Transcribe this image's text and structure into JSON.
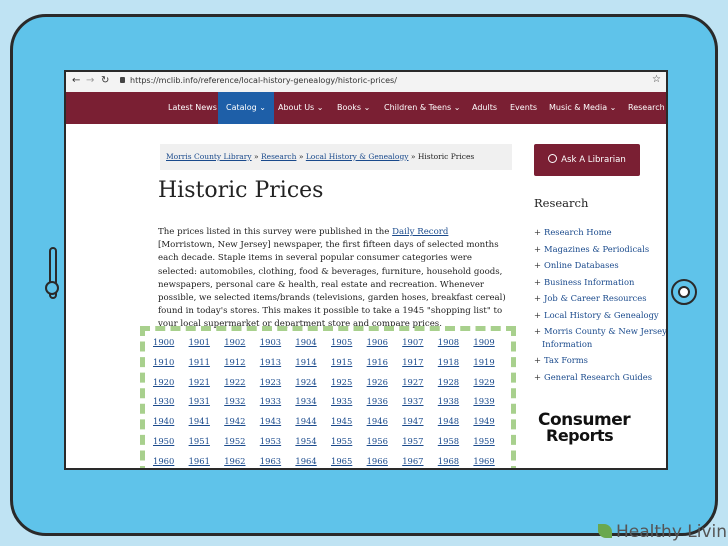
{
  "browser": {
    "url": "https://mclib.info/reference/local-history-genealogy/historic-prices/"
  },
  "nav": {
    "items": [
      "Latest News",
      "Catalog",
      "About Us",
      "Books",
      "Children & Teens",
      "Adults",
      "Events",
      "Music & Media",
      "Research"
    ],
    "active": "Catalog"
  },
  "breadcrumb": {
    "home": "Morris County Library",
    "sep": "»",
    "level1": "Research",
    "level2": "Local History & Genealogy",
    "current": "Historic Prices"
  },
  "page": {
    "title": "Historic Prices",
    "intro_before": "The prices listed in this survey were published in the ",
    "intro_link": "Daily Record",
    "intro_after": " [Morristown, New Jersey] newspaper, the first fifteen days of selected months each decade. Staple items in several popular consumer categories were selected: automobiles, clothing, food & beverages, furniture, household goods, newspapers, personal care & health, real estate and recreation. Whenever possible, we selected items/brands (televisions, garden hoses, breakfast cereal) found in today's stores. This makes it possible to take a 1945 \"shopping list\" to your local supermarket or department store and compare prices."
  },
  "years": [
    [
      "1900",
      "1901",
      "1902",
      "1903",
      "1904",
      "1905",
      "1906",
      "1907",
      "1908",
      "1909"
    ],
    [
      "1910",
      "1911",
      "1912",
      "1913",
      "1914",
      "1915",
      "1916",
      "1917",
      "1918",
      "1919"
    ],
    [
      "1920",
      "1921",
      "1922",
      "1923",
      "1924",
      "1925",
      "1926",
      "1927",
      "1928",
      "1929"
    ],
    [
      "1930",
      "1931",
      "1932",
      "1933",
      "1934",
      "1935",
      "1936",
      "1937",
      "1938",
      "1939"
    ],
    [
      "1940",
      "1941",
      "1942",
      "1943",
      "1944",
      "1945",
      "1946",
      "1947",
      "1948",
      "1949"
    ],
    [
      "1950",
      "1951",
      "1952",
      "1953",
      "1954",
      "1955",
      "1956",
      "1957",
      "1958",
      "1959"
    ],
    [
      "1960",
      "1961",
      "1962",
      "1963",
      "1964",
      "1965",
      "1966",
      "1967",
      "1968",
      "1969"
    ]
  ],
  "sidebar": {
    "ask_button": "Ask A Librarian",
    "research_heading": "Research",
    "links": [
      "Research Home",
      "Magazines & Periodicals",
      "Online Databases",
      "Business Information",
      "Job & Career Resources",
      "Local History & Genealogy",
      "Morris County & New Jersey",
      "Information",
      "Tax Forms",
      "General Research Guides"
    ],
    "logo_line1": "Consumer",
    "logo_line2": "Reports"
  },
  "watermark": "Healthy Living",
  "colors": {
    "nav": "#7a1f33",
    "active_tab": "#1e5fa8",
    "link": "#1a4a8c",
    "highlight": "#a8d08d",
    "tablet": "#5fc3ea"
  }
}
